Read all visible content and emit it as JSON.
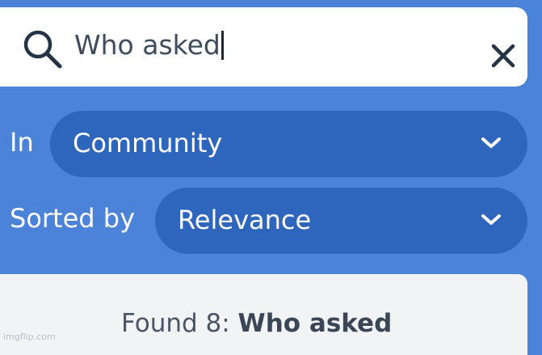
{
  "search": {
    "query": "Who asked"
  },
  "filters": {
    "in_label": "In",
    "in_value": "Community",
    "sort_label": "Sorted by",
    "sort_value": "Relevance"
  },
  "results": {
    "summary_prefix": "Found 8: ",
    "summary_query": "Who asked"
  },
  "watermark": "imgflip.com",
  "icons": {
    "search": "search-icon",
    "close": "close-icon",
    "dropdown": "chevron-down-icon"
  },
  "colors": {
    "background": "#4a83d8",
    "select_fill": "#2e66be",
    "search_bar": "#ffffff",
    "results_panel": "#f2f3f5",
    "icon_dark": "#253445"
  }
}
